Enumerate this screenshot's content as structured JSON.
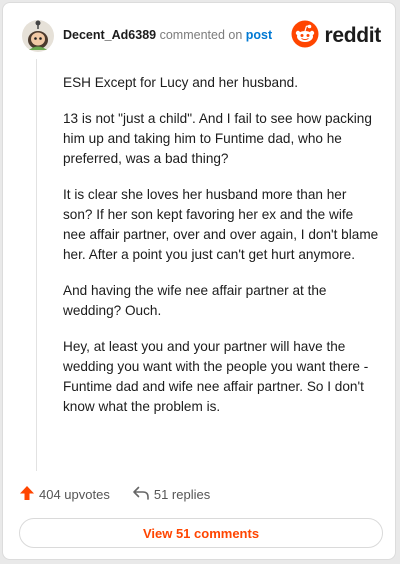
{
  "comment": {
    "username": "Decent_Ad6389",
    "action_text": "commented on",
    "post_link_text": "post",
    "paragraphs": [
      "ESH Except for Lucy and her husband.",
      "13 is not \"just a child\". And I fail to see how packing him up and taking him to Funtime dad, who he preferred, was a bad thing?",
      "It is clear she loves her husband more than her son? If her son kept favoring her ex and the wife nee affair partner, over and over again, I don't blame her. After a point you just can't get hurt anymore.",
      "And having the wife nee affair partner at the wedding? Ouch.",
      "Hey, at least you and your partner will have the wedding you want with the people you want there - Funtime dad and wife nee affair partner. So I don't know what the problem is."
    ]
  },
  "brand": {
    "name": "reddit",
    "color": "#ff4500"
  },
  "actions": {
    "upvotes_label": "404 upvotes",
    "replies_label": "51 replies"
  },
  "view_comments_label": "View 51 comments",
  "icons": {
    "avatar": "snoo-avatar",
    "logo": "reddit-logo-icon",
    "upvote": "upvote-arrow-icon",
    "reply": "reply-arrow-icon"
  }
}
